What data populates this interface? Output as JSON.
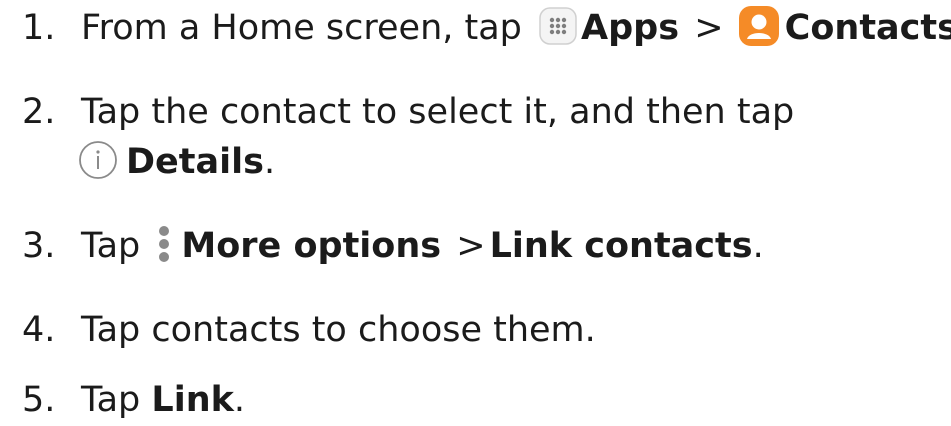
{
  "steps": [
    {
      "number": "1.",
      "prefix": "From a Home screen, tap",
      "apps_label": "Apps",
      "separator": ">",
      "contacts_label": "Contacts",
      "suffix": "."
    },
    {
      "number": "2.",
      "line1": "Tap the contact to select it, and then tap",
      "details_label": "Details",
      "suffix": "."
    },
    {
      "number": "3.",
      "prefix": "Tap",
      "more_label": "More options",
      "separator": ">",
      "link_contacts_label": "Link contacts",
      "suffix": "."
    },
    {
      "number": "4.",
      "text": "Tap contacts to choose them."
    },
    {
      "number": "5.",
      "prefix": "Tap",
      "link_label": "Link",
      "suffix": "."
    }
  ],
  "icons": {
    "apps": "apps-grid-icon",
    "contacts": "contacts-icon",
    "details": "info-icon",
    "more_options": "more-options-icon"
  },
  "colors": {
    "text": "#1b1b1b",
    "contacts_orange": "#f58b27",
    "icon_gray": "#8a8a8a"
  }
}
